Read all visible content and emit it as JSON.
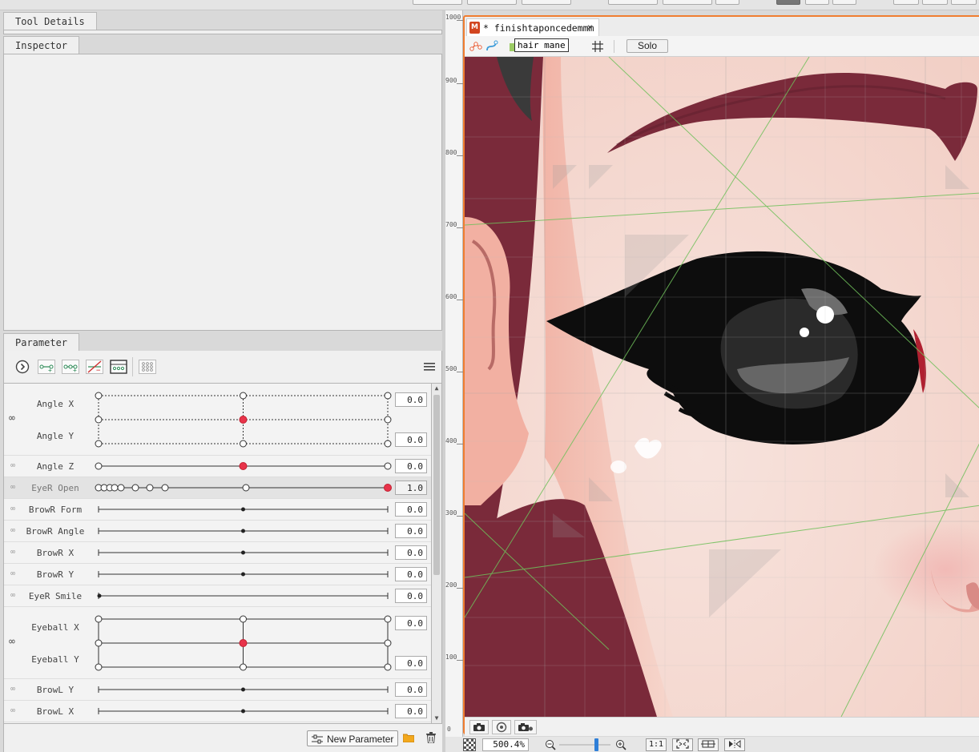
{
  "left_panel": {
    "tool_details_tab": "Tool Details",
    "inspector_tab": "Inspector",
    "parameter_tab": "Parameter"
  },
  "parameters": [
    {
      "id": "angle-x",
      "name": "Angle X",
      "value": "0.0"
    },
    {
      "id": "angle-y",
      "name": "Angle Y",
      "value": "0.0"
    },
    {
      "id": "angle-z",
      "name": "Angle Z",
      "value": "0.0"
    },
    {
      "id": "eyer-open",
      "name": "EyeR Open",
      "value": "1.0"
    },
    {
      "id": "browr-form",
      "name": "BrowR Form",
      "value": "0.0"
    },
    {
      "id": "browr-angle",
      "name": "BrowR Angle",
      "value": "0.0"
    },
    {
      "id": "browr-x",
      "name": "BrowR X",
      "value": "0.0"
    },
    {
      "id": "browr-y",
      "name": "BrowR Y",
      "value": "0.0"
    },
    {
      "id": "eyer-smile",
      "name": "EyeR Smile",
      "value": "0.0"
    },
    {
      "id": "eyeball-x",
      "name": "Eyeball X",
      "value": "0.0"
    },
    {
      "id": "eyeball-y",
      "name": "Eyeball Y",
      "value": "0.0"
    },
    {
      "id": "browl-y",
      "name": "BrowL Y",
      "value": "0.0"
    },
    {
      "id": "browl-x",
      "name": "BrowL X",
      "value": "0.0"
    }
  ],
  "footer": {
    "new_parameter_label": "New Parameter"
  },
  "viewer": {
    "document_tab": "* finishtaponcedemmm",
    "document_close": "×",
    "doc_icon_letter": "M",
    "tooltip": "hair mane",
    "solo_label": "Solo",
    "zoom_value": "500.4",
    "zoom_unit": "%",
    "ratio_label": "1:1"
  },
  "ruler_ticks": [
    "1000",
    "900",
    "800",
    "700",
    "600",
    "500",
    "400",
    "300",
    "200",
    "100",
    "0"
  ],
  "colors": {
    "accent_orange": "#f07d30",
    "keyframe_red": "#e8334a",
    "hair_maroon": "#7a2a3a",
    "skin": "#f6dad2",
    "eye_black": "#0d0d0d"
  }
}
